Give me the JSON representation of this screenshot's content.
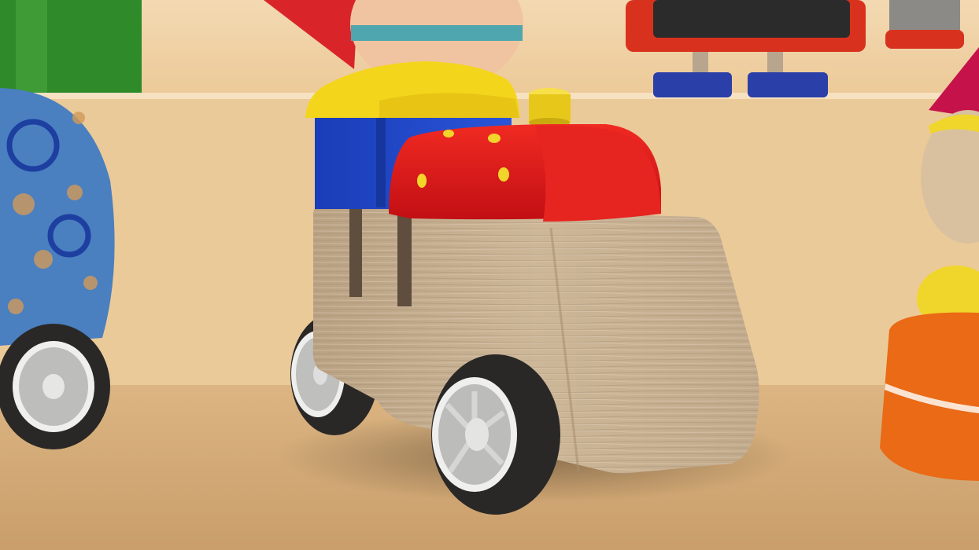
{
  "scene": {
    "subject": "wooden-toy-train",
    "colors": {
      "wall": "#f2d6ad",
      "shelf_top": "#efcfa2",
      "shelf_front": "#e8c596",
      "floor": "#d6b07e",
      "wood": "#c9b397",
      "wood_dark": "#a48c70",
      "cab_blue": "#1f45c8",
      "roof_yellow": "#f3d51c",
      "boiler_red": "#e01418",
      "dot_yellow": "#f1d52a",
      "tire": "#2a2826",
      "hub": "#c9c9c7",
      "toy_green": "#2f8a2a",
      "toy_blue": "#3a6fb5",
      "toy_orange": "#ea6a16",
      "toy_pink": "#c5124a"
    }
  }
}
